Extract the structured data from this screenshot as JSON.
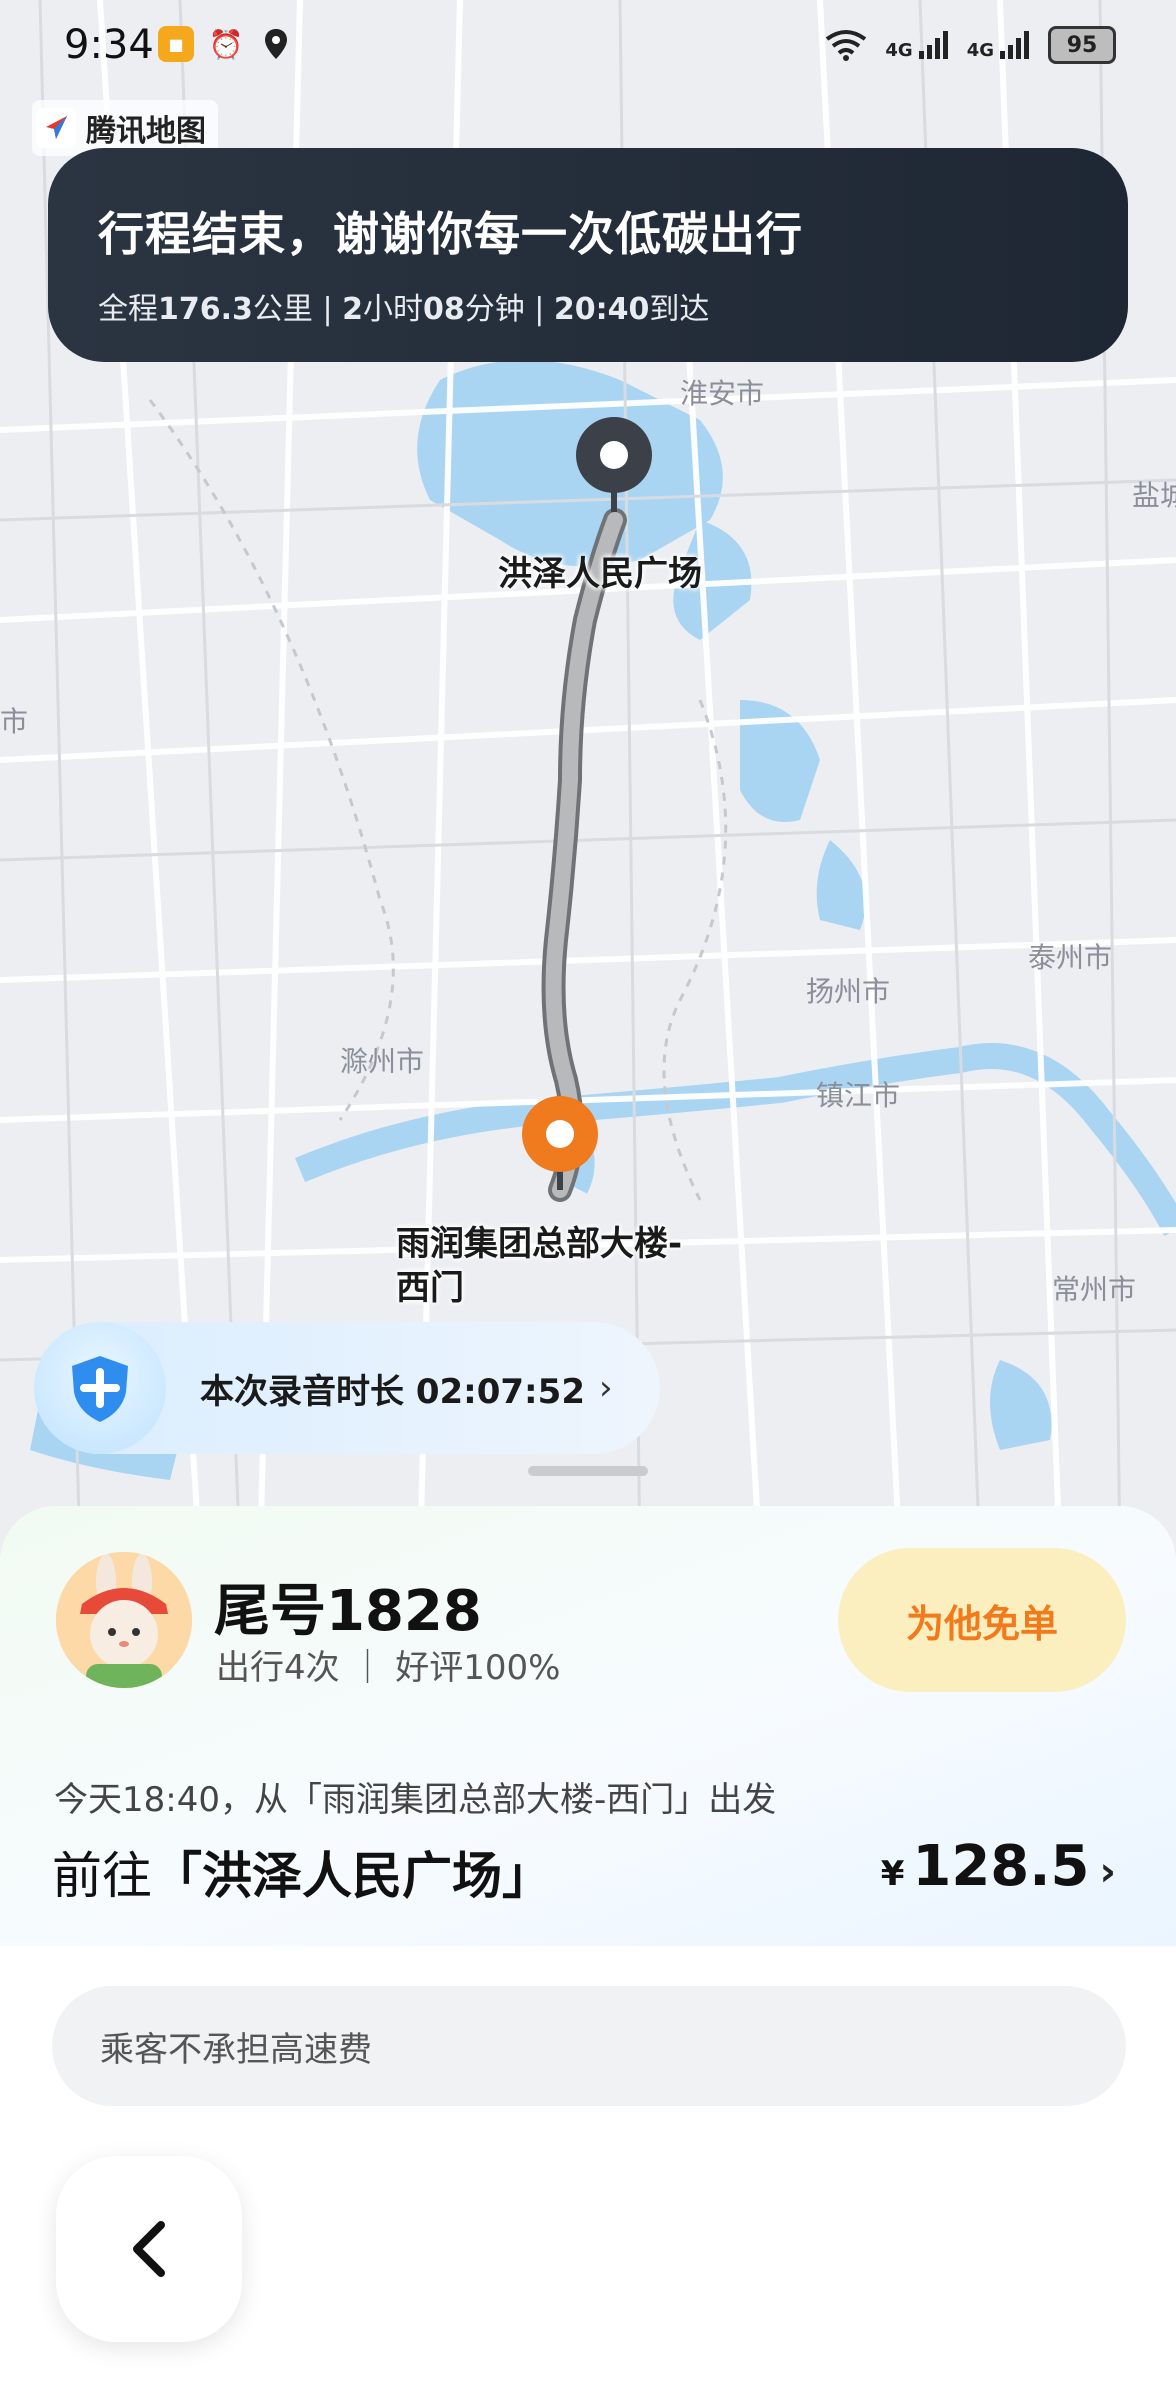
{
  "status_bar": {
    "time": "9:34",
    "battery": "95",
    "network_1": "4G",
    "network_2": "4G"
  },
  "brand": {
    "name": "腾讯地图"
  },
  "trip_banner": {
    "title": "行程结束，谢谢你每一次低碳出行",
    "distance_prefix": "全程",
    "distance_value": "176.3",
    "distance_unit": "公里 | ",
    "hours": "2",
    "hours_unit": "小时",
    "minutes": "08",
    "minutes_unit": "分钟 | ",
    "arrive_time": "20:40",
    "arrive_suffix": "到达"
  },
  "map": {
    "labels": [
      "淮安市",
      "盐城",
      "市",
      "扬州市",
      "泰州市",
      "滁州市",
      "镇江市",
      "常州市"
    ],
    "destination_name": "洪泽人民广场",
    "origin_name_line1": "雨润集团总部大楼-",
    "origin_name_line2": "西门",
    "colors": {
      "water": "#a9d5f3",
      "route": "#9b9b9b",
      "origin_pin": "#f07a1e",
      "dest_pin": "#3c4149"
    }
  },
  "recording": {
    "label": "本次录音时长 02:07:52",
    "chevron": "›"
  },
  "driver": {
    "name": "尾号1828",
    "stats": "出行4次  ｜  好评100%",
    "free_button": "为他免单"
  },
  "order": {
    "departure": "今天18:40，从「雨润集团总部大楼-西门」出发",
    "dest_prefix": "前往",
    "dest_name": "「洪泽人民广场」",
    "currency": "¥",
    "price": "128.5",
    "chevron": "›"
  },
  "notice": {
    "text": "乘客不承担高速费"
  },
  "nav": {
    "back_icon": "chevron-left-icon"
  }
}
